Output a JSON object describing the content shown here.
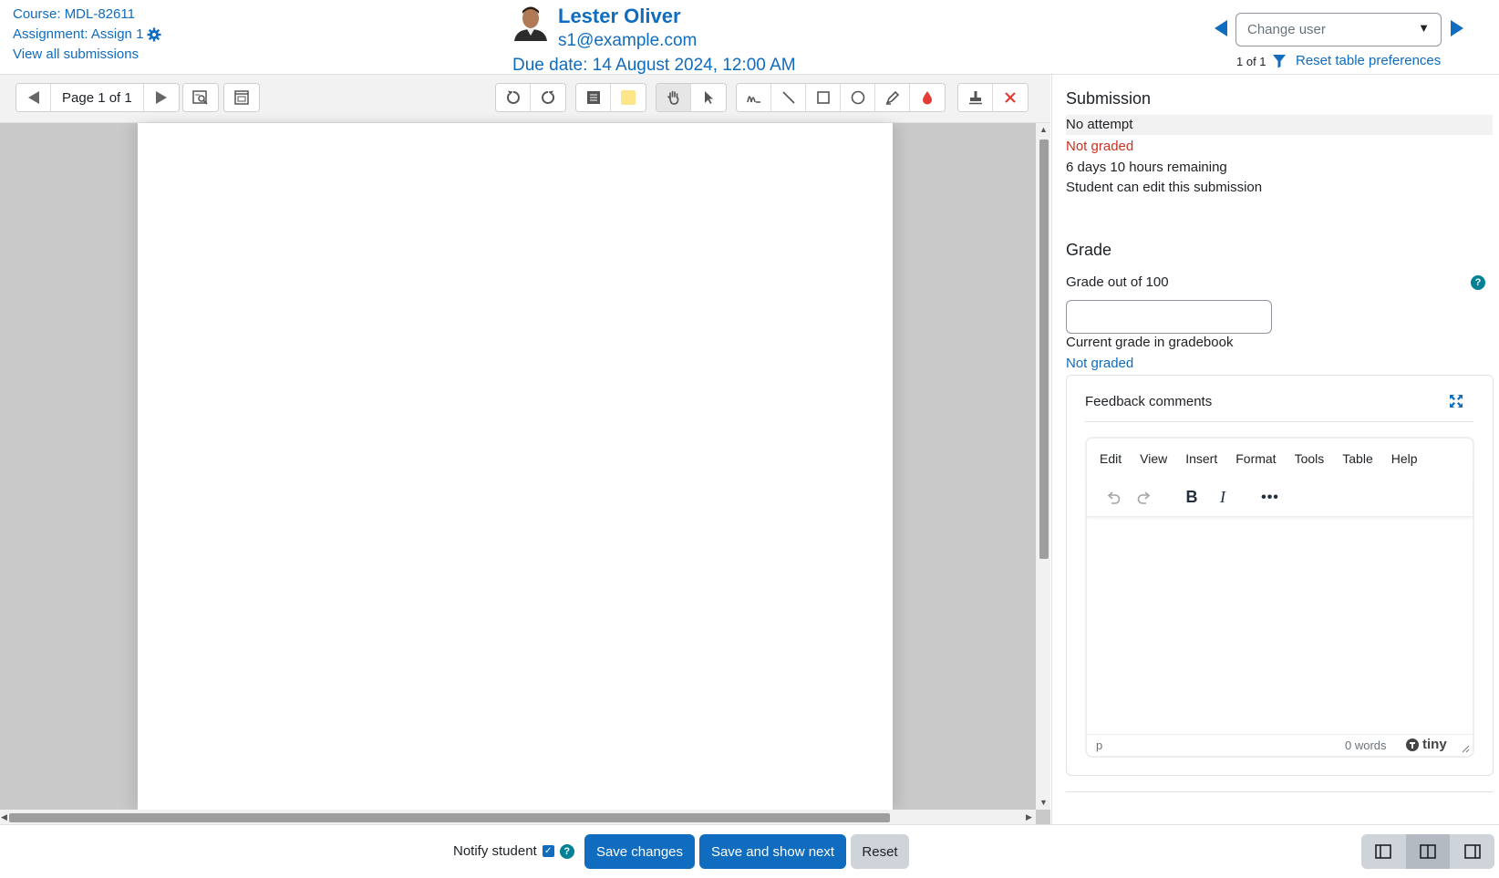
{
  "header": {
    "course": "Course: MDL-82611",
    "assignment": "Assignment: Assign 1",
    "view_all": "View all submissions",
    "user_name": "Lester Oliver",
    "user_email": "s1@example.com",
    "due_date": "Due date: 14 August 2024, 12:00 AM",
    "change_user_placeholder": "Change user",
    "user_count": "1 of 1",
    "reset_prefs": "Reset table preferences"
  },
  "toolbar": {
    "page_label": "Page 1 of 1",
    "colors": {
      "comment": "#fde68a",
      "annotation": "#e53935",
      "delete": "#e53935"
    }
  },
  "submission": {
    "heading": "Submission",
    "status": "No attempt",
    "grading_status": "Not graded",
    "time_remaining": "6 days 10 hours remaining",
    "edit_status": "Student can edit this submission"
  },
  "grade": {
    "heading": "Grade",
    "grade_label": "Grade out of 100",
    "grade_value": "",
    "current_label": "Current grade in gradebook",
    "current_value": "Not graded"
  },
  "feedback": {
    "title": "Feedback comments",
    "menu": [
      "Edit",
      "View",
      "Insert",
      "Format",
      "Tools",
      "Table",
      "Help"
    ],
    "status_path": "p",
    "word_count": "0 words",
    "brand": "tiny"
  },
  "footer": {
    "notify_label": "Notify student",
    "notify_checked": true,
    "save": "Save changes",
    "save_next": "Save and show next",
    "reset": "Reset"
  },
  "colors": {
    "accent": "#0f6cbf",
    "danger": "#ca3120",
    "info": "#008196"
  }
}
